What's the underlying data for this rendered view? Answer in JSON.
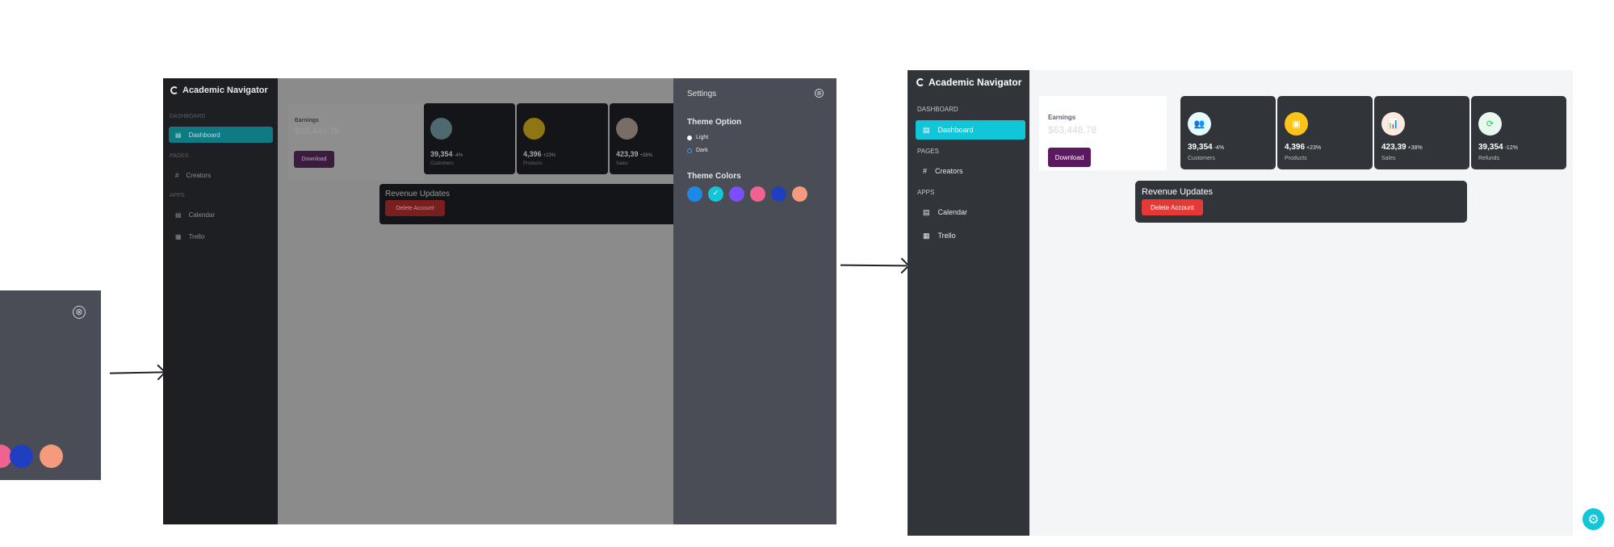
{
  "crop_panel": {
    "close_glyph": "⊗",
    "color_dots": [
      "#f06292",
      "#1e3fbf",
      "#f59a7d"
    ]
  },
  "shot1": {
    "logo": "Academic Navigator",
    "sections": [
      "DASHBOARD",
      "PAGES",
      "APPS"
    ],
    "nav": [
      {
        "label": "Dashboard",
        "icon": "calendar-icon"
      },
      {
        "label": "Creators",
        "icon": "hashtag-icon"
      },
      {
        "label": "Calendar",
        "icon": "calendar-icon"
      },
      {
        "label": "Trello",
        "icon": "board-icon"
      }
    ],
    "earnings": {
      "label": "Earnings",
      "value": "$63,448.78",
      "button": "Download"
    },
    "cards": [
      {
        "number": "39,354",
        "pct": "-4%",
        "caption": "Customers",
        "icon_bg": "#4e6a70"
      },
      {
        "number": "4,396",
        "pct": "+23%",
        "caption": "Products",
        "icon_bg": "#8f7612"
      },
      {
        "number": "423,39",
        "pct": "+38%",
        "caption": "Sales",
        "icon_bg": "#7a6d68"
      }
    ],
    "revenue": {
      "title": "Revenue Updates",
      "button": "Delete Account"
    },
    "settings": {
      "title": "Settings",
      "close_glyph": "⊗",
      "theme_option": "Theme Option",
      "light": "Light",
      "dark": "Dark",
      "theme_colors": "Theme Colors",
      "check": "✓",
      "colors": [
        "#1e88e5",
        "#12c6d9",
        "#7b4fff",
        "#f06292",
        "#1e3fbf",
        "#f59a7d"
      ]
    }
  },
  "shot2": {
    "logo": "Academic Navigator",
    "sections": [
      "DASHBOARD",
      "PAGES",
      "APPS"
    ],
    "nav": [
      {
        "label": "Dashboard",
        "icon": "calendar-icon"
      },
      {
        "label": "Creators",
        "icon": "hashtag-icon"
      },
      {
        "label": "Calendar",
        "icon": "calendar-icon"
      },
      {
        "label": "Trello",
        "icon": "board-icon"
      }
    ],
    "earnings": {
      "label": "Earnings",
      "value": "$63,448.78",
      "button": "Download"
    },
    "cards": [
      {
        "number": "39,354",
        "pct": "-4%",
        "caption": "Customers",
        "icon": "👥",
        "icon_bg": "#e6fbfd",
        "icon_color": "#12c6d9"
      },
      {
        "number": "4,396",
        "pct": "+23%",
        "caption": "Products",
        "icon": "▣",
        "icon_bg": "#fcc419",
        "icon_color": "#ffffff"
      },
      {
        "number": "423,39",
        "pct": "+38%",
        "caption": "Sales",
        "icon": "📊",
        "icon_bg": "#fde9df",
        "icon_color": "#e07a5f"
      },
      {
        "number": "39,354",
        "pct": "-12%",
        "caption": "Refunds",
        "icon": "⟳",
        "icon_bg": "#e8f8ef",
        "icon_color": "#22c55e"
      }
    ],
    "revenue": {
      "title": "Revenue Updates",
      "button": "Delete Account"
    }
  },
  "fab": {
    "glyph": "⚙"
  }
}
